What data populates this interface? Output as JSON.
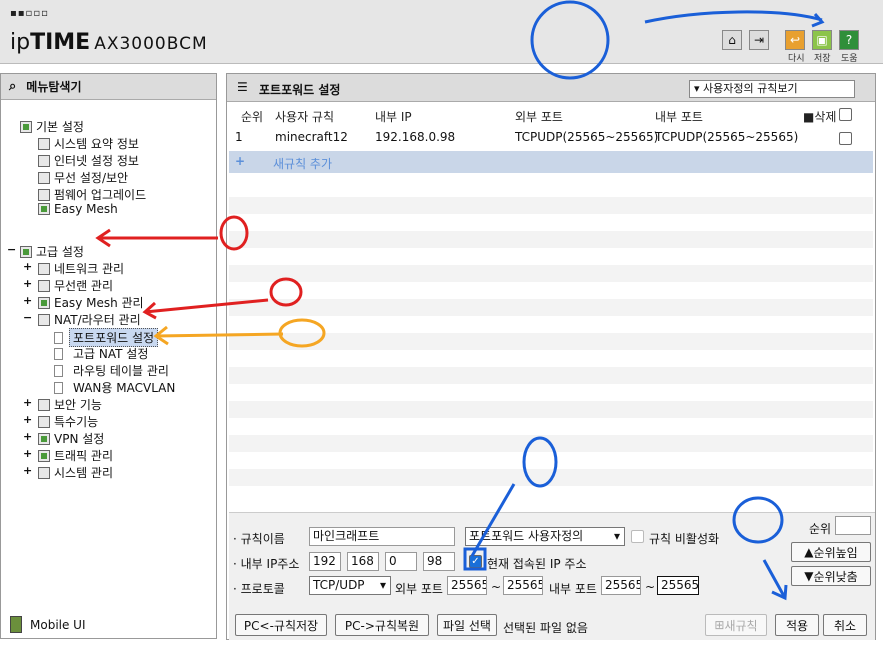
{
  "brand": {
    "dots": "▪▪▫▫▫",
    "name_light": "ip",
    "name_bold": "TIME",
    "model": "AX3000BCM"
  },
  "toolbar": {
    "home_icon": "home-icon",
    "logout_icon": "logout-icon",
    "save_short_label": "다시",
    "save_label": "저장",
    "help_label": "도움"
  },
  "left": {
    "header": "메뉴탐색기",
    "basic": "기본 설정",
    "basic_items": [
      "시스템 요약 정보",
      "인터넷 설정 정보",
      "무선 설정/보안",
      "펌웨어 업그레이드",
      "Easy Mesh"
    ],
    "advanced": "고급 설정",
    "adv_items": [
      "네트워크 관리",
      "무선랜 관리",
      "Easy Mesh 관리",
      "NAT/라우터 관리"
    ],
    "nat_items": [
      "포트포워드 설정",
      "고급 NAT 설정",
      "라우팅 테이블 관리",
      "WAN용 MACVLAN"
    ],
    "adv_items2": [
      "보안 기능",
      "특수기능",
      "VPN 설정",
      "트래픽 관리",
      "시스템 관리"
    ],
    "mobile": "Mobile UI"
  },
  "main": {
    "title": "포트포워드 설정",
    "view_select": "사용자정의 규칙보기",
    "columns": [
      "순위",
      "사용자 규칙",
      "내부 IP",
      "외부 포트",
      "내부 포트",
      "삭제"
    ],
    "rows": [
      {
        "rank": "1",
        "name": "minecraft12",
        "ip": "192.168.0.98",
        "ext": "TCPUDP(25565~25565)",
        "int": "TCPUDP(25565~25565)"
      }
    ],
    "add_rule": "새규칙 추가"
  },
  "form": {
    "rule_name_label": "규칙이름",
    "rule_name": "마인크래프트",
    "rule_type": "포트포워드 사용자정의",
    "disable_label": "규칙 비활성화",
    "ip_label": "내부 IP주소",
    "ip": [
      "192",
      "168",
      "0",
      "98"
    ],
    "current_ip_label": "현재 접속된 IP 주소",
    "proto_label": "프로토콜",
    "proto": "TCP/UDP",
    "ext_label": "외부 포트",
    "ext_from": "25565",
    "ext_to": "25565",
    "int_label": "내부 포트",
    "int_from": "25565",
    "int_to": "25565",
    "tilde": "~",
    "rank_label": "순위",
    "up": "순위높임",
    "down": "순위낮춤",
    "pc_save": "PC<-규칙저장",
    "pc_restore": "PC->규칙복원",
    "file_select": "파일 선택",
    "no_file": "선택된 파일 없음",
    "new_rule": "새규칙",
    "apply": "적용",
    "cancel": "취소"
  },
  "annotations": {
    "red": "①",
    "red2": "②",
    "orange": "③",
    "blue1": "①",
    "blue2": "②",
    "blue3": "③"
  },
  "colors": {
    "accent_row": "#c9d6e8",
    "selected": "#c8d8f0",
    "red": "#e02020",
    "orange": "#f5a623",
    "blue": "#1a5fd8"
  }
}
